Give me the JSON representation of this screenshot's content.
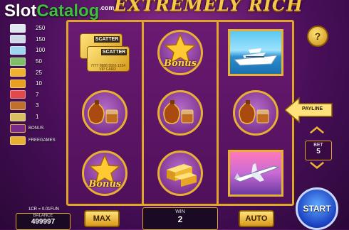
{
  "watermark": {
    "part1": "Slot",
    "part2": "Catalog",
    "suffix": ".com"
  },
  "game": {
    "title": "EXTREMELY RICH"
  },
  "paytable": {
    "rows": [
      {
        "icon": "car-icon",
        "value": "250",
        "color": "#dfe6f0"
      },
      {
        "icon": "jet-icon",
        "value": "150",
        "color": "#cfd8e8"
      },
      {
        "icon": "yacht-icon",
        "value": "100",
        "color": "#9ed6f0"
      },
      {
        "icon": "money-icon",
        "value": "50",
        "color": "#7fbf6a"
      },
      {
        "icon": "gold-coins-icon",
        "value": "25",
        "color": "#f0b030"
      },
      {
        "icon": "gold-bars-icon",
        "value": "10",
        "color": "#e8a020"
      },
      {
        "icon": "cocktail-icon",
        "value": "7",
        "color": "#e04a4a"
      },
      {
        "icon": "cognac-icon",
        "value": "3",
        "color": "#c0702a"
      },
      {
        "icon": "watch-icon",
        "value": "1",
        "color": "#d8c060"
      }
    ],
    "bonus_label": "BONUS",
    "freegames_label": "FREEGAMES"
  },
  "reels": {
    "scatter_label": "SCATTER",
    "card_number": "7777 8888 5555 1234",
    "vip_label": "VIP CARD",
    "bonus_label": "Bonus"
  },
  "controls": {
    "help_label": "?",
    "payline_label": "PAYLINE",
    "bet_label": "BET",
    "bet_value": "5",
    "start_label": "START",
    "max_label": "MAX",
    "auto_label": "AUTO",
    "cr_label": "1CR = 0.01FUN",
    "balance_label": "BALANCE",
    "balance_value": "499997",
    "win_label": "WIN",
    "win_value": "2"
  },
  "colors": {
    "gold": "#e0a628",
    "purple": "#5e1566",
    "start_blue": "#1a3fc0"
  }
}
